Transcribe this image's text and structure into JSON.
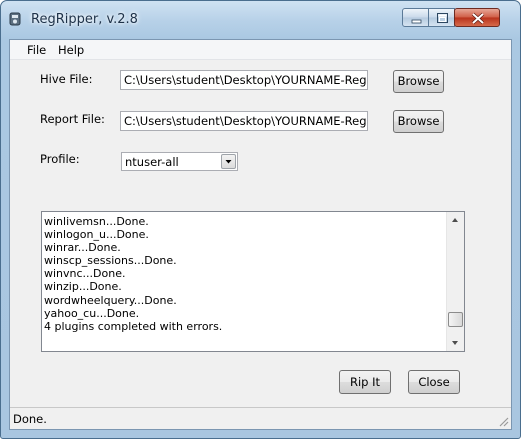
{
  "window": {
    "title": "RegRipper, v.2.8"
  },
  "menu": {
    "file": "File",
    "help": "Help"
  },
  "hive": {
    "label": "Hive File:",
    "value": "C:\\Users\\student\\Desktop\\YOURNAME-RegistryIn",
    "browse": "Browse"
  },
  "report": {
    "label": "Report File:",
    "value": "C:\\Users\\student\\Desktop\\YOURNAME-RegRipRe",
    "browse": "Browse"
  },
  "profile": {
    "label": "Profile:",
    "value": "ntuser-all"
  },
  "log": {
    "lines": [
      "winlivemsn...Done.",
      "winlogon_u...Done.",
      "winrar...Done.",
      "winscp_sessions...Done.",
      "winvnc...Done.",
      "winzip...Done.",
      "wordwheelquery...Done.",
      "yahoo_cu...Done.",
      "4 plugins completed with errors."
    ]
  },
  "buttons": {
    "rip": "Rip It",
    "close": "Close"
  },
  "status": {
    "text": "Done."
  }
}
